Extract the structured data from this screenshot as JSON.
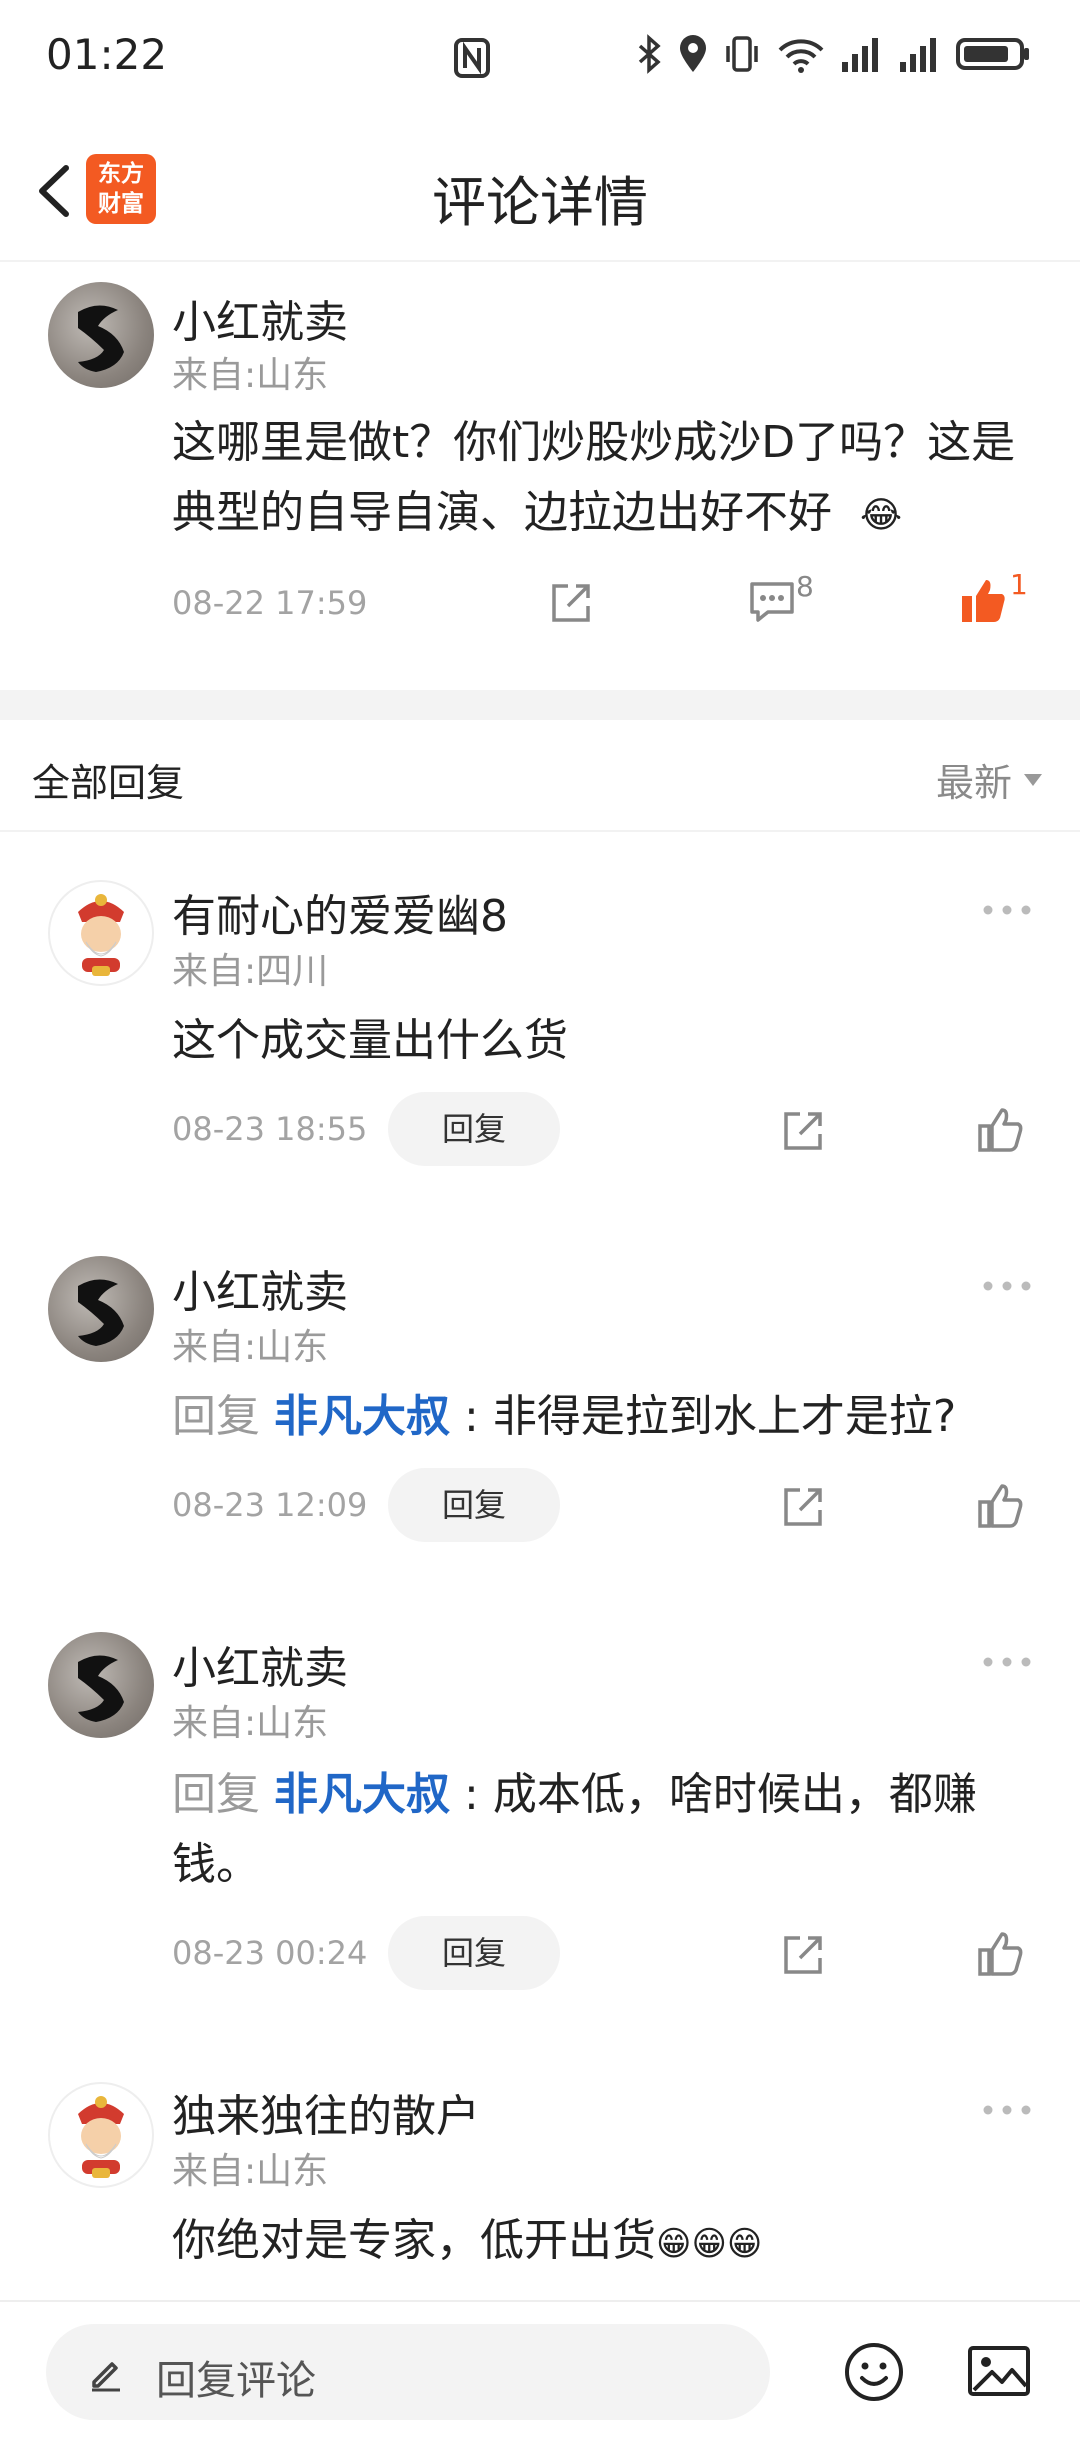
{
  "status_bar": {
    "time": "01:22"
  },
  "header": {
    "title": "评论详情",
    "logo_line1": "东方",
    "logo_line2": "财富"
  },
  "main_comment": {
    "username": "小红就卖",
    "location": "来自:山东",
    "text": "这哪里是做t？你们炒股炒成沙D了吗？这是典型的自导自演、边拉边出好不好",
    "emoji": "😂",
    "timestamp": "08-22 17:59",
    "comment_count": "8",
    "like_count": "1"
  },
  "replies_header": {
    "label": "全部回复",
    "sort_label": "最新"
  },
  "replies": [
    {
      "username": "有耐心的爱爱幽8",
      "location": "来自:四川",
      "text": "这个成交量出什么货",
      "timestamp": "08-23 18:55",
      "reply_label": "回复"
    },
    {
      "username": "小红就卖",
      "location": "来自:山东",
      "reply_prefix": "回复",
      "reply_to": "非凡大叔",
      "text": "非得是拉到水上才是拉?",
      "timestamp": "08-23 12:09",
      "reply_label": "回复"
    },
    {
      "username": "小红就卖",
      "location": "来自:山东",
      "reply_prefix": "回复",
      "reply_to": "非凡大叔",
      "text": "成本低，啥时候出，都赚钱。",
      "timestamp": "08-23 00:24",
      "reply_label": "回复"
    },
    {
      "username": "独来独往的散户",
      "location": "来自:山东",
      "text": "你绝对是专家，低开出货",
      "emoji": "😁😁😁"
    }
  ],
  "bottom_bar": {
    "input_placeholder": "回复评论"
  },
  "colors": {
    "accent_orange": "#f35a22",
    "link_blue": "#2067c7"
  }
}
